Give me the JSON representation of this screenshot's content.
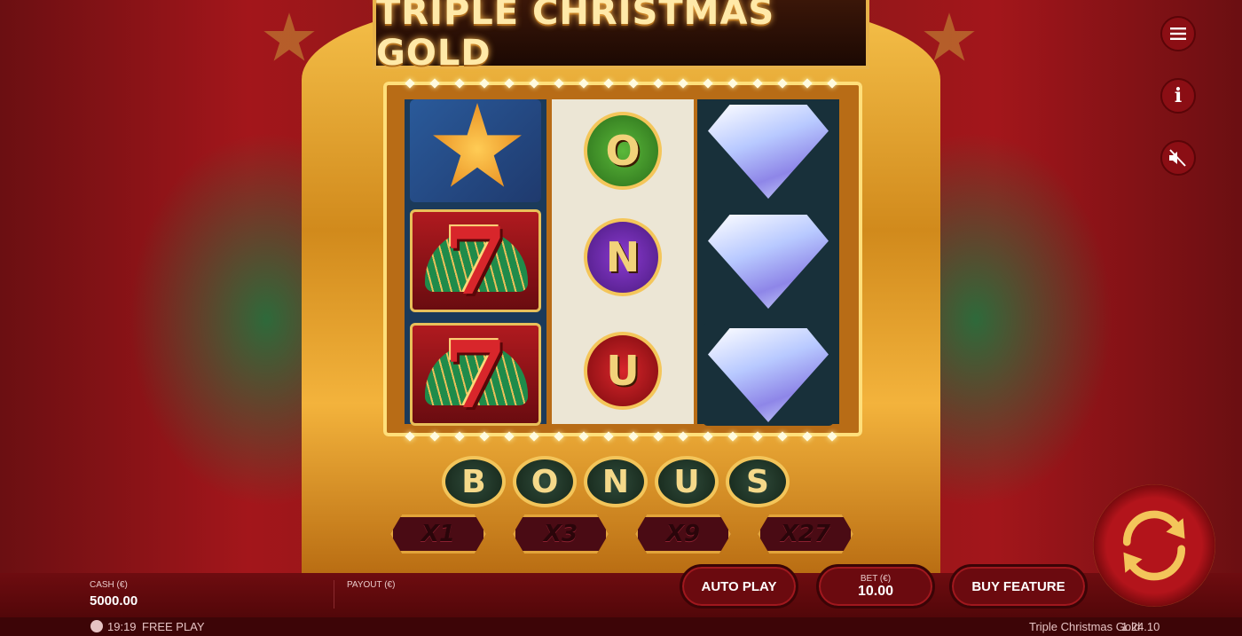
{
  "game": {
    "title": "TRIPLE CHRISTMAS GOLD"
  },
  "reels": {
    "reel1": [
      "star",
      "seven",
      "seven"
    ],
    "reel2": [
      "O",
      "N",
      "U"
    ],
    "reel3": [
      "diamond",
      "diamond",
      "diamond"
    ],
    "seven_label": "7"
  },
  "bonus": {
    "letters": [
      "B",
      "O",
      "N",
      "U",
      "S"
    ],
    "multipliers": [
      "X1",
      "X3",
      "X9",
      "X27"
    ]
  },
  "side_menu": {
    "menu_icon": "hamburger-icon",
    "info_icon": "info-icon",
    "sound_icon": "sound-muted-icon",
    "info_glyph": "i"
  },
  "footer": {
    "cash_label": "CASH (€)",
    "cash_value": "5000.00",
    "payout_label": "PAYOUT (€)",
    "auto_play": "AUTO PLAY",
    "bet_label": "BET (€)",
    "bet_value": "10.00",
    "buy_feature": "BUY FEATURE",
    "clock": "19:19",
    "mode": "FREE PLAY",
    "game_name": "Triple Christmas Gold",
    "version": "1.24.10"
  },
  "colors": {
    "accent_gold": "#f3c55a",
    "bar_red": "#6e0c10",
    "button_red": "#8b0e14"
  }
}
